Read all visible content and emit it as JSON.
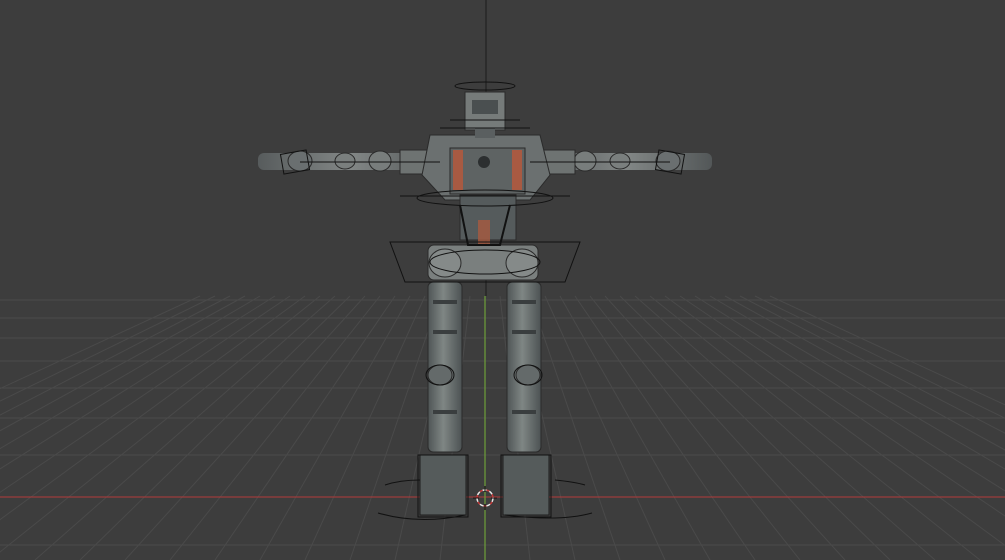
{
  "viewport": {
    "background": "#3d3d3d",
    "grid_color": "#4a4a4a",
    "x_axis_color": "#b33a3a",
    "z_axis_color": "#6f9f3a",
    "rig_line_color": "#111111"
  },
  "scene_objects": {
    "model": "robot-mesh",
    "rig": "armature-control-shapes",
    "cursor": "3d-cursor-icon"
  }
}
